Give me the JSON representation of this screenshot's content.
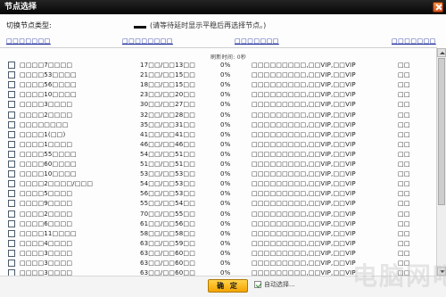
{
  "window": {
    "title": "节点选择"
  },
  "node_type": {
    "label": "切换节点类型:",
    "hint": "(请等待延时显示平稳后再选择节点。)"
  },
  "column_links": [
    "□□□□□□□",
    "□□□□□□□□",
    "□□□□□□□",
    "□□□□□□□"
  ],
  "list_info": "刷新时间: 0秒",
  "rows": [
    [
      "□□□□7□□□□",
      "17□□/□□13□□",
      "0%",
      "□□□□□□□□□,□□VIP,□□VIP",
      "□□"
    ],
    [
      "□□□□53□□□□",
      "21□□/□□15□□",
      "0%",
      "□□□□□□□□□,□□VIP,□□VIP",
      "□□"
    ],
    [
      "□□□□56□□□□",
      "18□□/□□15□□",
      "0%",
      "□□□□□□□□□,□□VIP,□□VIP",
      "□□"
    ],
    [
      "□□□□10□□□□",
      "23□□/□□20□□",
      "0%",
      "□□□□□□□□□,□□VIP,□□VIP",
      "□□"
    ],
    [
      "□□□□3□□□□",
      "30□□/□□27□□",
      "0%",
      "□□□□□□□□□,□□VIP,□□VIP",
      "□□"
    ],
    [
      "□□□□2□□□□",
      "32□□/□□28□□",
      "0%",
      "□□□□□□□□□,□□VIP,□□VIP",
      "□□"
    ],
    [
      "□□□□□□□□",
      "35□□/□□31□□",
      "0%",
      "□□□□□□□□□,□□VIP,□□VIP",
      "□□"
    ],
    [
      "□□□□1(□□)",
      "41□□/□□41□□",
      "0%",
      "□□□□□□□□□,□□VIP,□□VIP",
      "□□"
    ],
    [
      "□□□□1□□□□",
      "46□□/□□46□□",
      "0%",
      "□□□□□□□□□,□□VIP,□□VIP",
      "□□"
    ],
    [
      "□□□□55□□□□",
      "54□□/□□51□□",
      "0%",
      "□□□□□□□□□,□□VIP,□□VIP",
      "□□"
    ],
    [
      "□□□□60□□□□",
      "51□□/□□51□□",
      "0%",
      "□□□□□□□□□,□□VIP,□□VIP",
      "□□"
    ],
    [
      "□□□□10□□□□",
      "53□□/□□53□□",
      "0%",
      "□□□□□□□□□,□□VIP,□□VIP",
      "□□"
    ],
    [
      "□□□□2□□□□/□□□",
      "54□□/□□53□□",
      "0%",
      "□□□□□□□□□,□□VIP,□□VIP",
      "□□"
    ],
    [
      "□□□□5□□□□",
      "56□□/□□53□□",
      "0%",
      "□□□□□□□□□,□□VIP,□□VIP",
      "□□"
    ],
    [
      "□□□□9□□□□",
      "55□□/□□54□□",
      "0%",
      "□□□□□□□□□,□□VIP,□□VIP",
      "□□"
    ],
    [
      "□□□□2□□□□",
      "70□□/□□55□□",
      "0%",
      "□□□□□□□□□,□□VIP,□□VIP",
      "□□"
    ],
    [
      "□□□□6□□□□",
      "61□□/□□56□□",
      "0%",
      "□□□□□□□□□,□□VIP,□□VIP",
      "□□"
    ],
    [
      "□□□□11□□□□",
      "58□□/□□58□□",
      "0%",
      "□□□□□□□□□,□□VIP,□□VIP",
      "□□"
    ],
    [
      "□□□□4□□□□",
      "63□□/□□59□□",
      "0%",
      "□□□□□□□□□,□□VIP,□□VIP",
      "□□"
    ],
    [
      "□□□□3□□□□",
      "63□□/□□60□□",
      "0%",
      "□□□□□□□□□,□□VIP,□□VIP",
      "□□"
    ],
    [
      "□□□□3□□□□",
      "63□□/□□60□□",
      "0%",
      "□□□□□□□□□,□□VIP,□□VIP",
      "□□"
    ],
    [
      "□□□□3□□□□",
      "63□□/□□60□□",
      "0%",
      "□□□□□□□□□,□□VIP,□□VIP",
      "□□"
    ]
  ],
  "footer": {
    "ok_label": "确 定",
    "auto_label": "自动选择..."
  },
  "watermark": "电脑网吧"
}
